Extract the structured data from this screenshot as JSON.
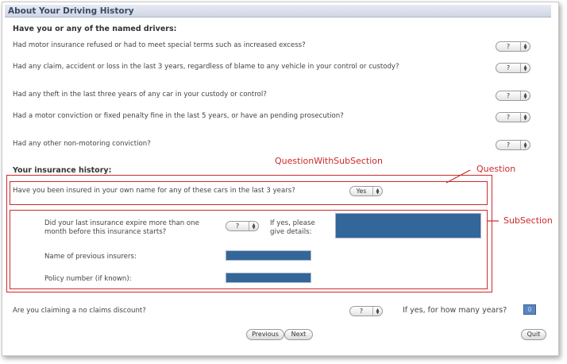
{
  "header": {
    "title": "About Your Driving History"
  },
  "drivers": {
    "title": "Have you or any of the named drivers:",
    "questions": [
      {
        "text": "Had motor insurance refused or had to meet special terms such as increased excess?",
        "value": "?"
      },
      {
        "text": "Had any claim, accident or loss in the last 3 years, regardless of blame to any vehicle in your control or custody?",
        "value": "?"
      },
      {
        "text": "Had any theft in the last three years of any car in your custody or control?",
        "value": "?"
      },
      {
        "text": "Had a motor conviction or fixed penalty fine in the last 5 years, or have an pending prosecution?",
        "value": "?"
      },
      {
        "text": "Had any other non-motoring conviction?",
        "value": "?"
      }
    ]
  },
  "insurance": {
    "title": "Your insurance history:",
    "question": {
      "text": "Have you been insured in your own name for any of these cars in the last 3 years?",
      "value": "Yes"
    },
    "subsection": {
      "expire_q_line1": "Did your last insurance expire more than one",
      "expire_q_line2": "month before this insurance starts?",
      "expire_value": "?",
      "details_line1": "If yes, please",
      "details_line2": "give details:",
      "prev_insurers_label": "Name of previous insurers:",
      "policy_label": "Policy number (if known):"
    },
    "ncd": {
      "text": "Are you claiming a no claims discount?",
      "value": "?",
      "years_label": "If yes, for how many years?",
      "years_value": "0"
    }
  },
  "buttons": {
    "previous": "Previous",
    "next": "Next",
    "quit": "Quit"
  },
  "annotations": {
    "question_with_subsection": "QuestionWithSubSection",
    "question": "Question",
    "subsection": "SubSection"
  },
  "colors": {
    "annotation_red": "#cc2a2a",
    "field_blue": "#336699"
  }
}
